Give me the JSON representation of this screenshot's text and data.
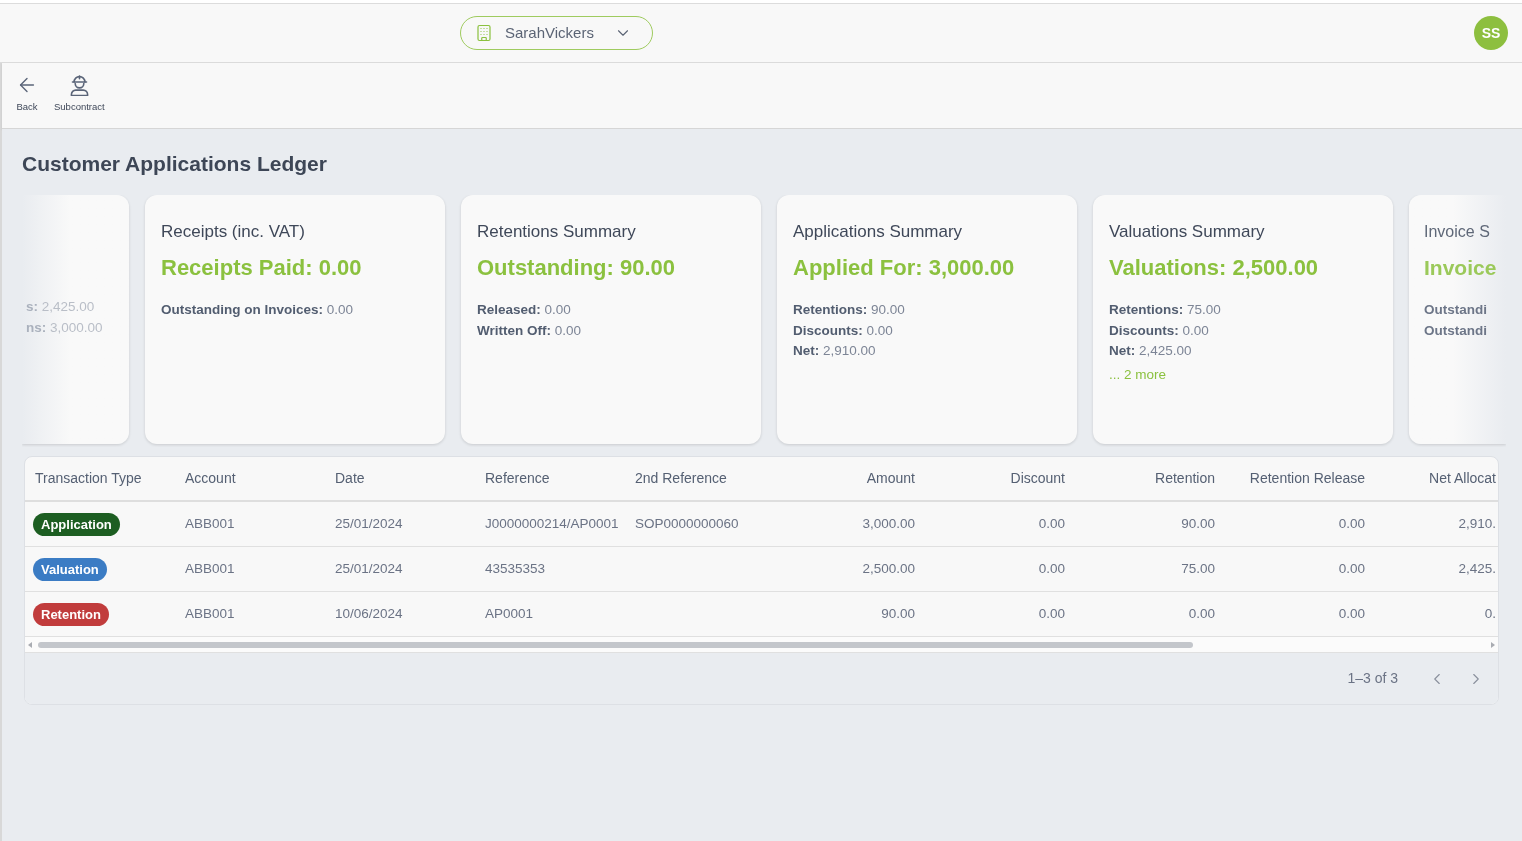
{
  "header": {
    "account_selector": {
      "value": "SarahVickers"
    },
    "avatar": {
      "initials": "SS"
    }
  },
  "toolbar": [
    {
      "kind": "back",
      "label": "Back"
    },
    {
      "kind": "subcontract",
      "label": "Subcontract"
    }
  ],
  "page_title": "Customer Applications Ledger",
  "summary_cards": [
    {
      "kind": "cut_left",
      "lines": [
        {
          "label": "s:",
          "value": "2,425.00"
        },
        {
          "label": "ns:",
          "value": "3,000.00"
        }
      ]
    },
    {
      "kind": "full",
      "title": "Receipts (inc. VAT)",
      "headline": "Receipts Paid: 0.00",
      "lines": [
        {
          "label": "Outstanding on Invoices:",
          "value": "0.00"
        }
      ]
    },
    {
      "kind": "full",
      "title": "Retentions Summary",
      "headline": "Outstanding: 90.00",
      "lines": [
        {
          "label": "Released:",
          "value": "0.00"
        },
        {
          "label": "Written Off:",
          "value": "0.00"
        }
      ]
    },
    {
      "kind": "full",
      "title": "Applications Summary",
      "headline": "Applied For: 3,000.00",
      "lines": [
        {
          "label": "Retentions:",
          "value": "90.00"
        },
        {
          "label": "Discounts:",
          "value": "0.00"
        },
        {
          "label": "Net:",
          "value": "2,910.00"
        }
      ]
    },
    {
      "kind": "full",
      "title": "Valuations Summary",
      "headline": "Valuations: 2,500.00",
      "lines": [
        {
          "label": "Retentions:",
          "value": "75.00"
        },
        {
          "label": "Discounts:",
          "value": "0.00"
        },
        {
          "label": "Net:",
          "value": "2,425.00"
        }
      ],
      "more_link": "... 2 more"
    },
    {
      "kind": "cut_right",
      "title": "Invoice S",
      "headline": "Invoice",
      "lines": [
        {
          "label": "Outstandi"
        },
        {
          "label": "Outstandi"
        }
      ]
    }
  ],
  "table": {
    "columns": [
      "Transaction Type",
      "Account",
      "Date",
      "Reference",
      "2nd Reference",
      "Amount",
      "Discount",
      "Retention",
      "Retention Release",
      "Net Allocat"
    ],
    "rows": [
      {
        "color": "#1d5e22",
        "cells": [
          "Application",
          "ABB001",
          "25/01/2024",
          "J0000000214/AP0001",
          "SOP0000000060",
          "3,000.00",
          "0.00",
          "90.00",
          "0.00",
          "2,910."
        ]
      },
      {
        "color": "#3b7cc4",
        "cells": [
          "Valuation",
          "ABB001",
          "25/01/2024",
          "43535353",
          "",
          "2,500.00",
          "0.00",
          "75.00",
          "0.00",
          "2,425."
        ]
      },
      {
        "color": "#c13c3c",
        "cells": [
          "Retention",
          "ABB001",
          "10/06/2024",
          "AP0001",
          "",
          "90.00",
          "0.00",
          "0.00",
          "0.00",
          "0."
        ]
      }
    ]
  },
  "pagination": {
    "range": "1–3 of 3"
  }
}
